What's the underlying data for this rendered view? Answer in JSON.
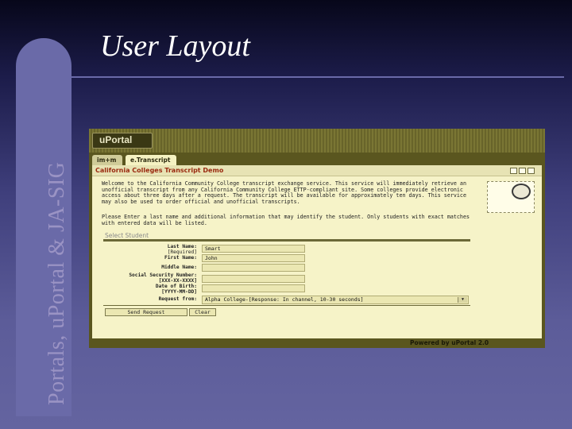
{
  "slide": {
    "title": "User Layout",
    "side_title": "Portals, uPortal & JA-SIG"
  },
  "portal": {
    "logo_text": "uPortal",
    "tabs": [
      {
        "label": "im+m"
      },
      {
        "label": "e.Transcript"
      }
    ],
    "channel_title": "California Colleges Transcript Demo",
    "intro_text": "Welcome to the California Community College transcript exchange service. This service will immediately retrieve an unofficial transcript from any California Community College ETTP-compliant site. Some colleges provide electronic access about three days after a request. The transcript will be available for approximately ten days. This service may also be used to order official and unofficial transcripts.",
    "instructions_text": "Please Enter a last name and additional information that may identify the student. Only students with exact matches with entered data will be listed.",
    "section_title": "Select Student",
    "form": {
      "last_name_label": "Last Name:",
      "last_name_required": "[Required]",
      "last_name_value": "Smart",
      "first_name_label": "First Name:",
      "first_name_value": "John",
      "middle_name_label": "Middle Name:",
      "middle_name_value": "",
      "ssn_label": "Social Security Number:",
      "ssn_format": "[XXX-XX-XXXX]",
      "ssn_value": "",
      "dob_label": "Date of Birth:",
      "dob_format": "[YYYY-MM-DD]",
      "dob_value": "",
      "request_from_label": "Request from:",
      "request_from_value": "Alpha College-[Response: In channel, 10-30 seconds]"
    },
    "buttons": {
      "send_request": "Send Request",
      "clear": "Clear"
    },
    "footer_text": "Powered by uPortal 2.0"
  },
  "colors": {
    "background_top": "#07071a",
    "background_bottom": "#6464a0",
    "side_bar": "#6a6aa8",
    "channel_bg": "#f6f3c8",
    "channel_title": "#9a2a10",
    "portal_frame": "#5a561f"
  },
  "icons": [
    "edit-icon",
    "minimize-icon",
    "close-icon",
    "seal-icon",
    "select-arrow-icon"
  ]
}
